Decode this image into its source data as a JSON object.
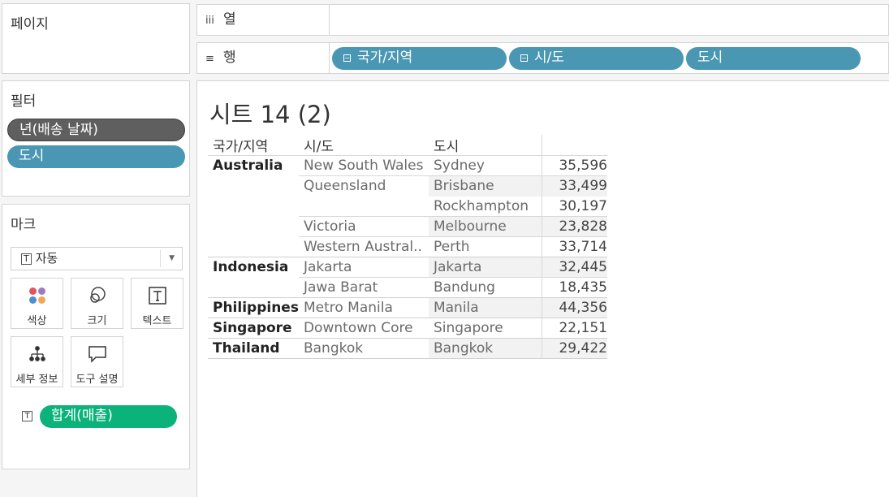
{
  "pages": {
    "title": "페이지"
  },
  "filters": {
    "title": "필터",
    "items": [
      "년(배송 날짜)",
      "도시"
    ]
  },
  "marks": {
    "title": "마크",
    "mark_type": "자동",
    "mark_type_icon": "text-icon",
    "buttons": [
      {
        "label": "색상",
        "icon": "color-icon"
      },
      {
        "label": "크기",
        "icon": "size-icon"
      },
      {
        "label": "텍스트",
        "icon": "text-icon"
      },
      {
        "label": "세부 정보",
        "icon": "detail-icon"
      },
      {
        "label": "도구 설명",
        "icon": "tooltip-icon"
      }
    ],
    "measure_pill": "합계(매출)"
  },
  "shelves": {
    "columns": {
      "label": "열",
      "icon": "iii"
    },
    "rows": {
      "label": "행",
      "icon": "≡",
      "pills": [
        "국가/지역",
        "시/도",
        "도시"
      ]
    }
  },
  "sheet": {
    "title": "시트 14 (2)",
    "headers": [
      "국가/지역",
      "시/도",
      "도시",
      ""
    ],
    "rows": [
      {
        "country": "Australia",
        "state": "New South Wales",
        "city": "Sydney",
        "value": "35,596"
      },
      {
        "country": "",
        "state": "Queensland",
        "city": "Brisbane",
        "value": "33,499"
      },
      {
        "country": "",
        "state": "",
        "city": "Rockhampton",
        "value": "30,197"
      },
      {
        "country": "",
        "state": "Victoria",
        "city": "Melbourne",
        "value": "23,828"
      },
      {
        "country": "",
        "state": "Western Austral..",
        "city": "Perth",
        "value": "33,714"
      },
      {
        "country": "Indonesia",
        "state": "Jakarta",
        "city": "Jakarta",
        "value": "32,445"
      },
      {
        "country": "",
        "state": "Jawa Barat",
        "city": "Bandung",
        "value": "18,435"
      },
      {
        "country": "Philippines",
        "state": "Metro Manila",
        "city": "Manila",
        "value": "44,356"
      },
      {
        "country": "Singapore",
        "state": "Downtown Core",
        "city": "Singapore",
        "value": "22,151"
      },
      {
        "country": "Thailand",
        "state": "Bangkok",
        "city": "Bangkok",
        "value": "29,422"
      }
    ]
  },
  "colors": {
    "dimension_pill": "#4a97b4",
    "filter_dark_pill": "#5f5f5f",
    "measure_pill": "#0bb37a"
  }
}
